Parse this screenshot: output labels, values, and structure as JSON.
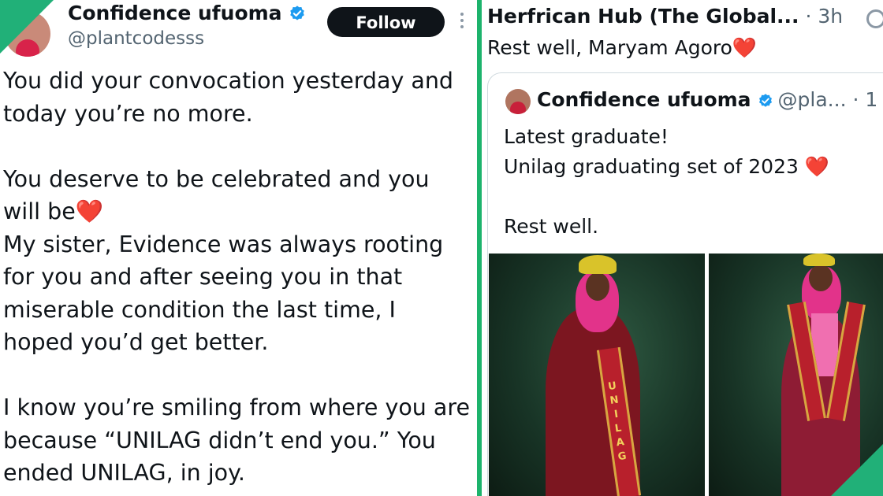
{
  "left_post": {
    "author_name": "Confidence ufuoma",
    "handle": "@plantcodesss",
    "follow_label": "Follow",
    "paragraphs": [
      [
        "You did your convocation yesterday and",
        "today you’re no more."
      ],
      [
        "You deserve to be celebrated and you",
        "will be",
        "My sister, Evidence was always rooting",
        "for you and after seeing you in that",
        "miserable condition the last time, I",
        "hoped you’d get better."
      ],
      [
        "I know you’re smiling from where you are",
        "because “UNILAG didn’t end you.” You",
        "ended UNILAG, in joy."
      ]
    ],
    "heart": "❤️"
  },
  "right_post": {
    "author_name": "Herfrican Hub (The Global...",
    "time": "· 3h",
    "text": "Rest well, Maryam Agoro",
    "heart": "❤️",
    "quote": {
      "author_name": "Confidence ufuoma",
      "handle": "@pla... · 1",
      "lines": [
        "Latest graduate!",
        "Unilag graduating set of 2023",
        "Rest well."
      ],
      "heart": "❤️",
      "stole_text": "UNILAG"
    }
  },
  "colors": {
    "accent_green": "#21b078",
    "verified_blue": "#1d9bf0",
    "follow_bg": "#0f1419"
  }
}
